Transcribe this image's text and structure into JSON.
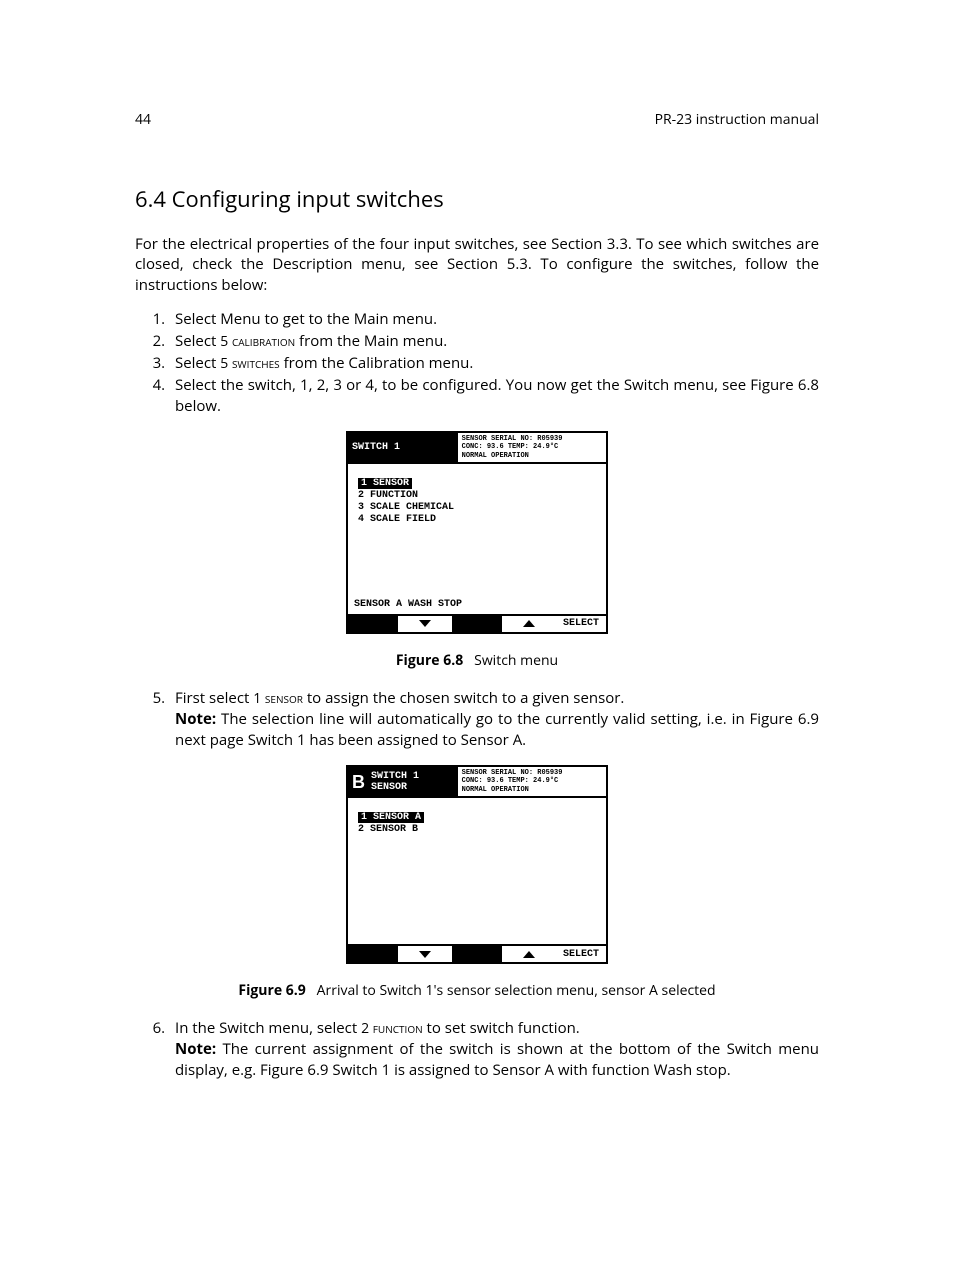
{
  "header": {
    "page_number": "44",
    "title": "PR-23 instruction manual"
  },
  "section": {
    "heading": "6.4  Configuring input switches",
    "intro": "For the electrical properties of the four input switches, see Section 3.3. To see which switches are closed, check the Description menu, see Section 5.3. To configure the switches, follow the instructions below:"
  },
  "steps_a": {
    "s1": "Select Menu to get to the Main menu.",
    "s2_a": "Select ",
    "s2_sc": "5 calibration",
    "s2_b": " from the Main menu.",
    "s3_a": "Select ",
    "s3_sc": "5 switches",
    "s3_b": " from the Calibration menu.",
    "s4": "Select the switch, 1, 2, 3 or 4, to be configured. You now get the Switch menu, see Figure 6.8 below."
  },
  "figure68": {
    "top_left": "SWITCH 1",
    "top_right": "SENSOR SERIAL NO: R05939\nCONC: 93.6     TEMP: 24.9°C\nNORMAL OPERATION",
    "menu": {
      "m1": "1 SENSOR",
      "m2": "2 FUNCTION",
      "m3": "3 SCALE CHEMICAL",
      "m4": "4 SCALE FIELD"
    },
    "status": "SENSOR A WASH STOP",
    "select": "SELECT",
    "caption_label": "Figure 6.8",
    "caption_text": "Switch menu"
  },
  "steps_b": {
    "s5_a": "First select ",
    "s5_sc": "1 sensor",
    "s5_b": " to assign the chosen switch to a given sensor.",
    "s5_note_label": "Note:",
    "s5_note": "  The selection line will automatically go to the currently valid setting, i.e. in Figure 6.9 next page Switch 1 has been assigned to Sensor A."
  },
  "figure69": {
    "top_left_b": "B",
    "top_left": "SWITCH 1\nSENSOR",
    "top_right": "SENSOR SERIAL NO: R05939\nCONC: 93.6     TEMP: 24.9°C\nNORMAL OPERATION",
    "menu": {
      "m1": "1 SENSOR A",
      "m2": "2 SENSOR B"
    },
    "select": "SELECT",
    "caption_label": "Figure 6.9",
    "caption_text": "Arrival to Switch 1's sensor selection menu, sensor A selected"
  },
  "steps_c": {
    "s6_a": "In the Switch menu, select ",
    "s6_sc": "2 function",
    "s6_b": " to set switch function.",
    "s6_note_label": "Note:",
    "s6_note": "  The current assignment of the switch is shown at the bottom of the Switch menu display, e.g. Figure 6.9 Switch 1 is assigned to Sensor A with function Wash stop."
  }
}
